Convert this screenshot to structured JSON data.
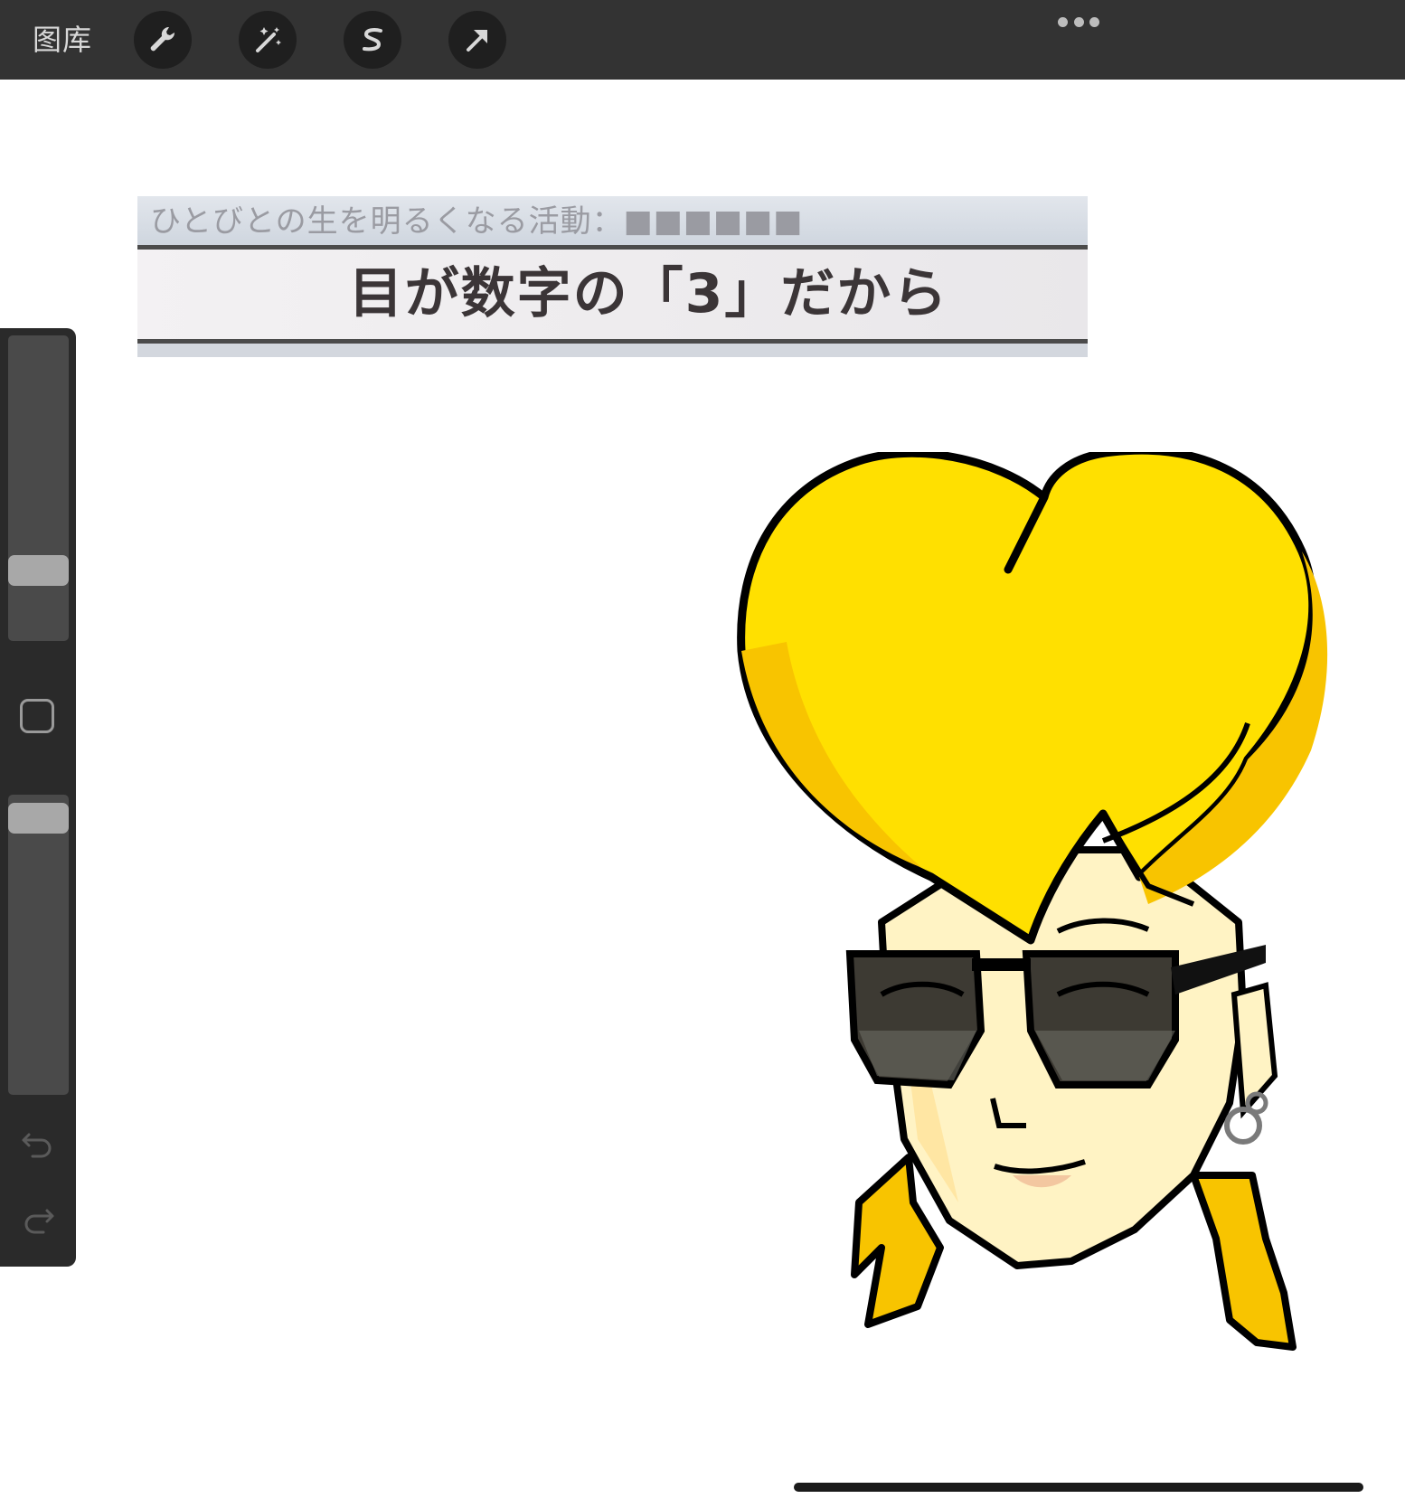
{
  "topbar": {
    "gallery_label": "图库",
    "tools": [
      {
        "name": "wrench-icon"
      },
      {
        "name": "magic-wand-icon"
      },
      {
        "name": "selection-s-icon"
      },
      {
        "name": "transform-arrow-icon"
      }
    ],
    "more_icon": "ellipsis-icon"
  },
  "sidebar": {
    "brush_size": 0.2,
    "opacity": 0.97,
    "modify_icon": "square-icon",
    "undo_icon": "undo-icon",
    "redo_icon": "redo-icon"
  },
  "canvas": {
    "caption_top_text": "ひとびとの生を明るくなる活動：■■■■■■",
    "caption_main_text": "目が数字の「3」だから"
  },
  "colors": {
    "topbar": "#333333",
    "sidebar": "#2a2a2a",
    "hair": "#ffe000",
    "hair_shade": "#f8c400",
    "skin": "#fff3c4",
    "outline": "#000000"
  }
}
